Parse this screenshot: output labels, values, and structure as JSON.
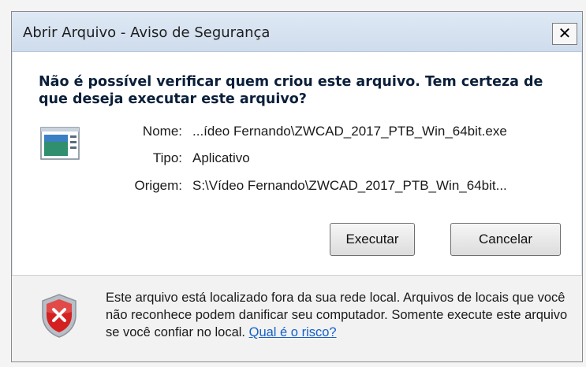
{
  "window": {
    "title": "Abrir Arquivo - Aviso de Segurança",
    "close_label": "✕"
  },
  "main": {
    "heading": "Não é possível verificar quem criou este arquivo. Tem certeza de que deseja executar este arquivo?",
    "fields": [
      {
        "label": "Nome:",
        "value": "...ídeo Fernando\\ZWCAD_2017_PTB_Win_64bit.exe"
      },
      {
        "label": "Tipo:",
        "value": "Aplicativo"
      },
      {
        "label": "Origem:",
        "value": "S:\\Vídeo Fernando\\ZWCAD_2017_PTB_Win_64bit..."
      }
    ],
    "icon": "application-icon"
  },
  "buttons": {
    "run": "Executar",
    "cancel": "Cancelar"
  },
  "footer": {
    "icon": "shield-warning-icon",
    "text": "Este arquivo está localizado fora da sua rede local. Arquivos de locais que você não reconhece podem danificar seu computador. Somente execute este arquivo se você confiar no local.",
    "link": "Qual é o risco?"
  },
  "colors": {
    "titlebar": "#d6e3f1",
    "link": "#1560c8",
    "shield_red": "#d42020"
  }
}
